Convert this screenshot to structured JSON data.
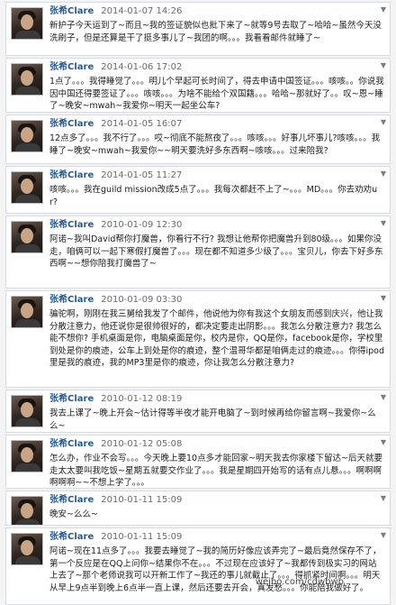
{
  "author": "张希Clare",
  "posts": [
    {
      "date": "2014-01-07 14:26",
      "text": "新护子今天运到了~而且~我的签证貌似也批下来了~就等9号去取了~哈哈~虽然今天没洗刷子，但是还算是干了挺多事儿了~我团的啊。。。我看看邮件就睡了~"
    },
    {
      "date": "2014-01-06 17:02",
      "text": "1点了。。。我得睡觉了。。。明儿个早起可长时间了，得去申请中国签证。。。咳咳。。你说我因中国还得要签证了。。。咳咳。。。为啥不能给个双国籍。。。哈哈~那就好了。。叹~恩~睡了~晚安~mwah~我爱你~明天一起坐公车?"
    },
    {
      "date": "2014-01-05 16:07",
      "text": "12点多了。。。我不行了。。。哎~彻底不能熬夜了。。。咳咳。。。好事儿坏事儿?咳咳。。。我睡了~晚安~mwah~我爱你~~明天要洗好多东西啊~咳咳。。。过来陪我?"
    },
    {
      "date": "2014-01-05 11:27",
      "text": "咳咳。。。我在guild mission改成5点了。。。我每次都赶不上了~。。。MD。。。你去劝劝ur?"
    },
    {
      "date": "2010-01-09 12:30",
      "text": "阿诺~我叫David帮你打魔兽，你看行不行? 我想让他帮你把魔兽升到80级。。。如果你没走，咱俩可以一起下寒假打魔兽了。。。现在都不知道多少级了。。。宝贝儿，你去下好多东西啊~~想你陪我打魔兽了~"
    },
    {
      "date": "2010-01-09 03:30",
      "text": "骗驼啊，刚刚在我三舅给我发了个邮件，他说他为你有我这个女朋友而感到庆兴，他让我分散注意力，他还说你是很帅很好的，都决定要走出阴影。。。我怎么分散注意力? 我怎么能不想你? 手机桌面是你，电脑桌面是你，校内是你，QQ是你，facebook是你，学校里到处是你的痕迹，公车上到处是你的痕迹，整个温哥华都是咱俩走过的痕迹。。。你得ipod里是我的痕迹，我的MP3里是你的痕迹，你让我怎么分散注意力?"
    },
    {
      "date": "2010-01-12 08:19",
      "text": "我去上课了~晚上开会~估计得等半夜才能开电脑了~到时候再给你留言啊~我爱你~么么~"
    },
    {
      "date": "2010-01-12 05:08",
      "text": "怎么办，作业不会写。。。今天晚上要10点多才能回家~明天我去你家楼下留达~后天就要走太太要叫我吃饭~星期五就要交作业了。。。我是星期四开始写的话有点儿悬。。。啊啊啊啊啊啊~~不想上学了。。。"
    },
    {
      "date": "2010-01-11 15:09",
      "text": "晚安~么么~"
    },
    {
      "date": "2010-01-11 15:09",
      "text": "阿诺~现在11点多了。。。我要去睡觉了~我的简历好像应该弄完了~最后竟然保存不了，第一个反应是在QQ上问你~结果你不在。。。不过现在应该好了~我都传到极实习的网站上去了~那个老师说我可以开新工作了~我还的事儿就截止了。。。得抓紧时间啊。。。明天从早上9点半到晚上6点半一直上课，然后还要去开会，真发愁。。。你能陪我做好了。"
    }
  ],
  "watermark": "weibo.com/cdwbwb"
}
